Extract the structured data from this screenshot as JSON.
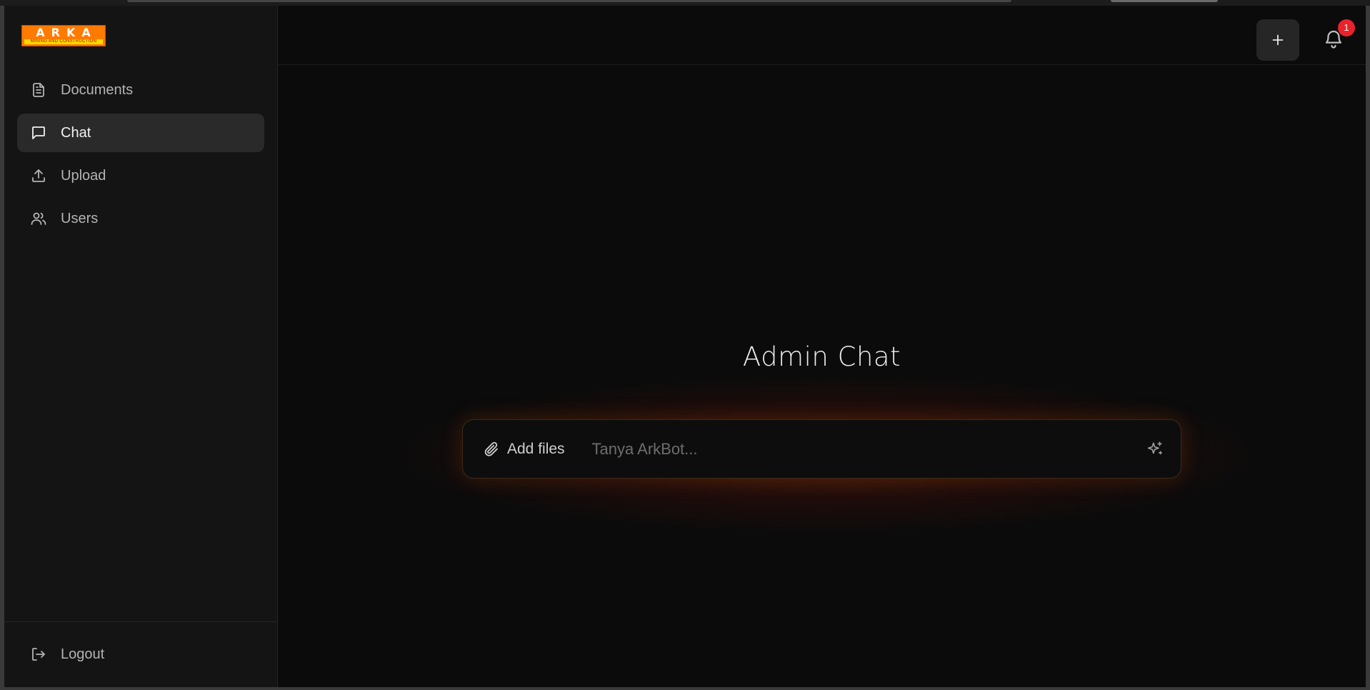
{
  "brand": {
    "logo_text": "ARKA",
    "logo_subtext": "MINING AND CONSTRUCTION",
    "colors": {
      "primary": "#ff7a00",
      "sub_band": "#ffd800",
      "sub_text": "#b00000"
    }
  },
  "sidebar": {
    "items": [
      {
        "label": "Documents",
        "icon": "document-icon",
        "active": false
      },
      {
        "label": "Chat",
        "icon": "chat-icon",
        "active": true
      },
      {
        "label": "Upload",
        "icon": "upload-icon",
        "active": false
      },
      {
        "label": "Users",
        "icon": "users-icon",
        "active": false
      }
    ],
    "footer": {
      "logout_label": "Logout",
      "icon": "logout-icon"
    }
  },
  "header": {
    "new_button_icon": "plus-icon",
    "notifications": {
      "icon": "bell-icon",
      "count": "1",
      "badge_color": "#e8232c"
    }
  },
  "main": {
    "title": "Admin Chat",
    "composer": {
      "add_files_label": "Add files",
      "placeholder": "Tanya ArkBot...",
      "value": "",
      "send_icon": "sparkle-icon"
    },
    "accent_glow": "#be3c00"
  }
}
